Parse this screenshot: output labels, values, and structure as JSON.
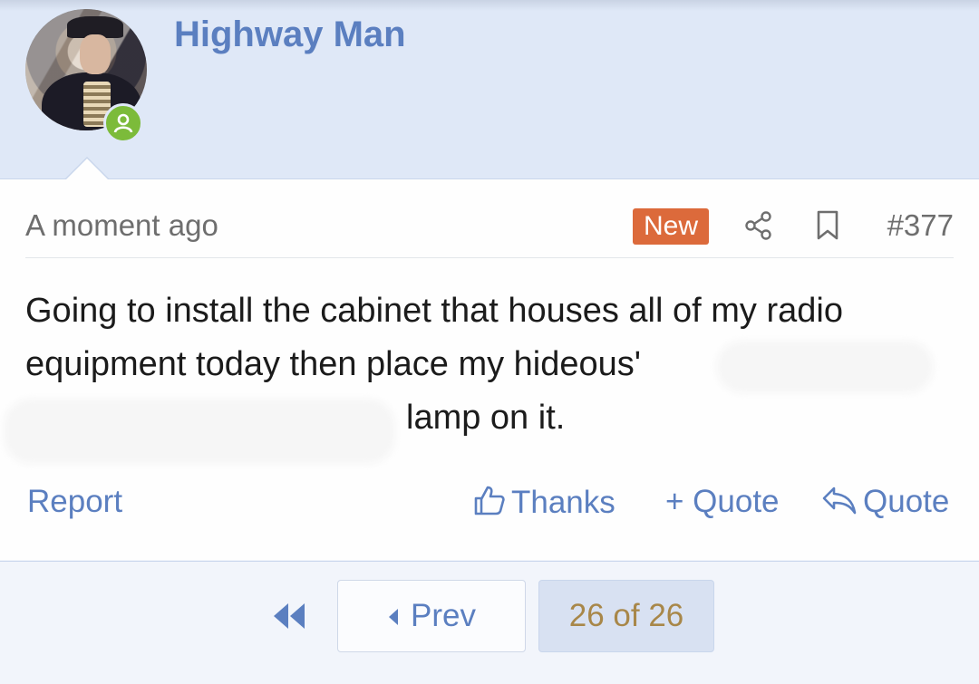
{
  "user": {
    "name": "Highway Man",
    "status": "online"
  },
  "post": {
    "timestamp": "A moment ago",
    "badge": "New",
    "number": "#377",
    "body_line1": "Going to install the cabinet that houses all of my radio",
    "body_line2": "equipment today then place my hideous'",
    "body_line3": "lamp on it."
  },
  "actions": {
    "report": "Report",
    "thanks": "Thanks",
    "plus_quote": "+ Quote",
    "quote": "Quote"
  },
  "pagination": {
    "prev": "Prev",
    "current": "26 of 26"
  },
  "colors": {
    "header_bg": "#dfe8f7",
    "link": "#5b7fc0",
    "new_badge": "#dc6a3b",
    "online": "#7cbb3a",
    "page_indicator_text": "#a88749"
  },
  "icons": [
    "user-icon",
    "share-icon",
    "bookmark-icon",
    "thumbs-up-icon",
    "plus-icon",
    "reply-icon",
    "double-left-arrow-icon",
    "left-caret-icon"
  ]
}
